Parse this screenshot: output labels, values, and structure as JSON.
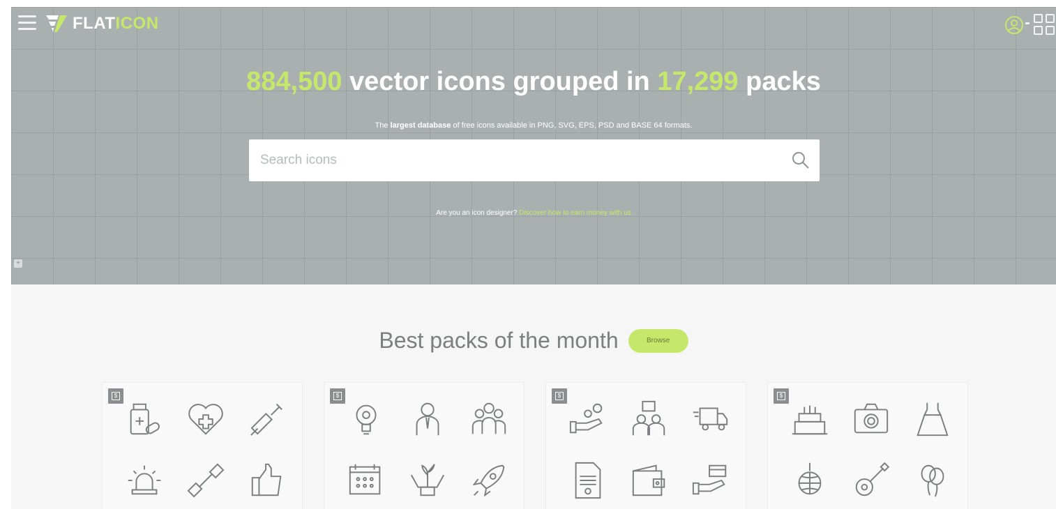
{
  "header": {
    "logo_text_plain": "FLAT",
    "logo_text_accent": "ICON"
  },
  "hero": {
    "headline_num1": "884,500",
    "headline_mid": " vector icons grouped in ",
    "headline_num2": "17,299",
    "headline_end": " packs",
    "subline_pre": "The ",
    "subline_bold": "largest database",
    "subline_post": " of free icons available in PNG, SVG, EPS, PSD and BASE 64 formats.",
    "search_placeholder": "Search icons",
    "designer_question": "Are you an icon designer? ",
    "designer_link": "Discover how to earn money with us"
  },
  "packs": {
    "title": "Best packs of the month",
    "browse_label": "Browse",
    "badge_text": "$",
    "cards": [
      {
        "icons": [
          "pill-bottle-icon",
          "heart-cross-icon",
          "syringe-icon",
          "siren-icon",
          "dumbbell-icon",
          "thumbs-up-icon"
        ]
      },
      {
        "icons": [
          "lightbulb-gear-icon",
          "businessman-icon",
          "team-icon",
          "calendar-icon",
          "hands-plant-icon",
          "rocket-icon"
        ]
      },
      {
        "icons": [
          "hand-coin-icon",
          "people-question-icon",
          "delivery-truck-icon",
          "certificate-document-icon",
          "wallet-icon",
          "hand-card-icon"
        ]
      },
      {
        "icons": [
          "birthday-cake-icon",
          "camera-icon",
          "dress-icon",
          "disco-ball-icon",
          "guitar-icon",
          "balloons-icon"
        ]
      }
    ]
  },
  "colors": {
    "accent": "#c6e86a",
    "hero_bg": "#aab0b0",
    "icon_stroke": "#7a7e7e"
  }
}
